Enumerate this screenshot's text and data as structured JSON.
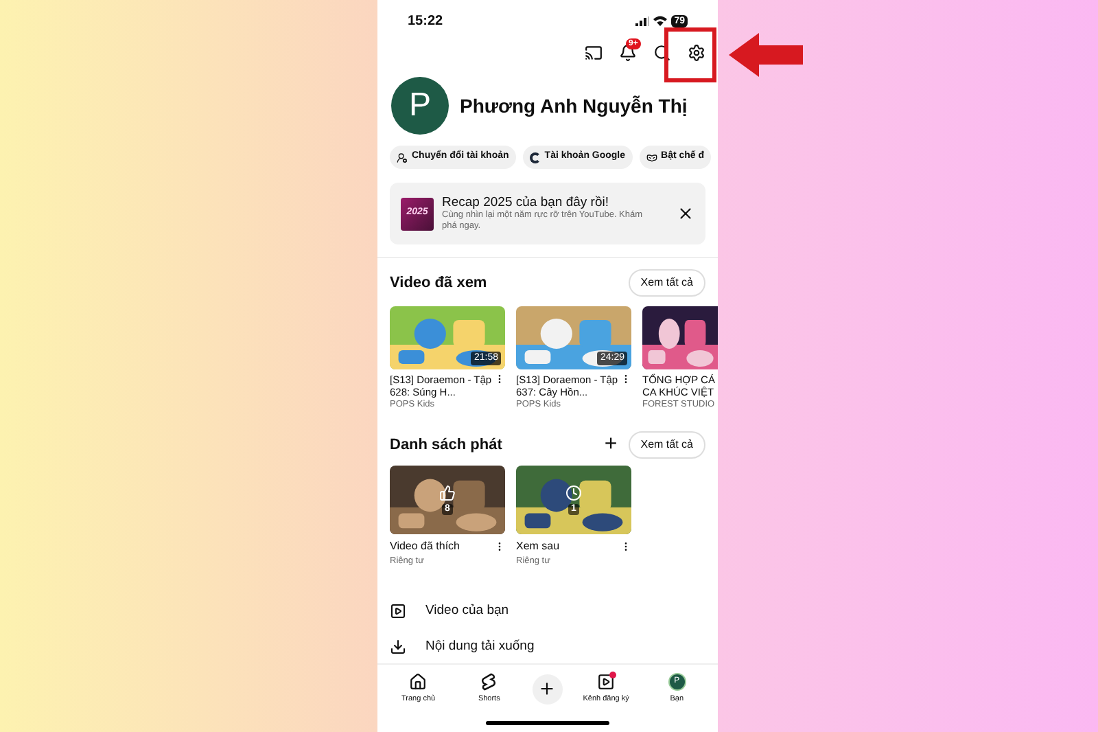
{
  "status_bar": {
    "time": "15:22",
    "battery": "79"
  },
  "top_bar": {
    "notification_badge": "9+"
  },
  "profile": {
    "initial": "P",
    "name": "Phương Anh Nguyễn Thị"
  },
  "chips": [
    {
      "kind": "switch",
      "label": "Chuyển đổi tài khoản"
    },
    {
      "kind": "google",
      "label": "Tài khoản Google"
    },
    {
      "kind": "incognito",
      "label": "Bật chế đ"
    }
  ],
  "recap": {
    "badge": "2025",
    "title": "Recap 2025 của bạn đây rồi!",
    "text": "Cùng nhìn lại một năm rực rỡ trên YouTube. Khám phá ngay."
  },
  "history": {
    "title": "Video đã xem",
    "button": "Xem tất cả",
    "videos": [
      {
        "title": "[S13] Doraemon - Tập 628: Súng H...",
        "channel": "POPS Kids",
        "duration": "21:58"
      },
      {
        "title": "[S13] Doraemon - Tập 637: Cây Hồn...",
        "channel": "POPS Kids",
        "duration": "24:29"
      },
      {
        "title": "TỔNG HỢP CÁ CA KHÚC VIỆT",
        "channel": "FOREST STUDIO"
      }
    ]
  },
  "playlists": {
    "title": "Danh sách phát",
    "add": "+",
    "button": "Xem tất cả",
    "items": [
      {
        "kind": "liked",
        "title": "Video đã thích",
        "privacy": "Riêng tư",
        "count": "8"
      },
      {
        "kind": "later",
        "title": "Xem sau",
        "privacy": "Riêng tư",
        "count": "1"
      }
    ]
  },
  "library": [
    {
      "kind": "video",
      "label": "Video của bạn"
    },
    {
      "kind": "download",
      "label": "Nội dung tải xuống"
    }
  ],
  "nav": [
    {
      "kind": "home",
      "label": "Trang chủ"
    },
    {
      "kind": "shorts",
      "label": "Shorts"
    },
    {
      "kind": "create"
    },
    {
      "kind": "subs",
      "label": "Kênh đăng ký"
    },
    {
      "kind": "you",
      "label": "Bạn",
      "initial": "P"
    }
  ]
}
